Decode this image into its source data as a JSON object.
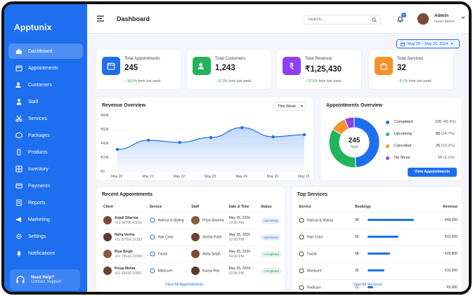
{
  "app": {
    "name": "Apptunix"
  },
  "sidebar": {
    "items": [
      {
        "label": "Dashboard",
        "icon": "home-icon",
        "active": true
      },
      {
        "label": "Appointments",
        "icon": "calendar-icon"
      },
      {
        "label": "Customers",
        "icon": "users-icon"
      },
      {
        "label": "Staff",
        "icon": "staff-icon"
      },
      {
        "label": "Services",
        "icon": "scissors-icon"
      },
      {
        "label": "Packages",
        "icon": "package-icon"
      },
      {
        "label": "Products",
        "icon": "product-icon"
      },
      {
        "label": "Inventory",
        "icon": "inventory-icon"
      },
      {
        "label": "Payments",
        "icon": "card-icon"
      },
      {
        "label": "Reports",
        "icon": "reports-icon"
      },
      {
        "label": "Marketing",
        "icon": "megaphone-icon"
      },
      {
        "label": "Settings",
        "icon": "gear-icon"
      },
      {
        "label": "Notifications",
        "icon": "bell-icon"
      }
    ],
    "help": {
      "title": "Need Help?",
      "subtitle": "Contact Support"
    }
  },
  "header": {
    "title": "Dashboard",
    "search_placeholder": "Search...",
    "notification_count": "5",
    "user_name": "Admin",
    "user_role": "Super Admin"
  },
  "date_range": "May 20 – May 26, 2024",
  "stats": [
    {
      "label": "Total Appointments",
      "value": "245",
      "change": "18.5%",
      "note": "from last week",
      "color": "#1e6ff0",
      "icon": "calendar-icon"
    },
    {
      "label": "Total Customers",
      "value": "1,243",
      "change": "12.3%",
      "note": "from last week",
      "color": "#22b45a",
      "icon": "users-icon"
    },
    {
      "label": "Total Revenue",
      "value": "₹1,25,430",
      "change": "22.6%",
      "note": "from last week",
      "color": "#8e3ff0",
      "icon": "rupee-icon"
    },
    {
      "label": "Total Services",
      "value": "32",
      "change": "8.7%",
      "note": "from last week",
      "color": "#f5922a",
      "icon": "bag-icon"
    }
  ],
  "revenue": {
    "title": "Revenue Overview",
    "period": "This Week"
  },
  "chart_data": [
    {
      "type": "area",
      "title": "Revenue Overview",
      "x": [
        "May 20",
        "May 21",
        "May 22",
        "May 23",
        "May 24",
        "May 25",
        "May 26"
      ],
      "series": [
        {
          "values": [
            32000,
            45000,
            42000,
            49000,
            63000,
            50000,
            53000
          ]
        }
      ],
      "yticks": [
        "₹80K",
        "₹60K",
        "₹40K",
        "₹20K",
        "₹0"
      ],
      "ylim": [
        0,
        80000
      ],
      "grid": true
    },
    {
      "type": "pie",
      "title": "Appointments Overview",
      "center_value": "245",
      "center_label": "Total",
      "slices": [
        {
          "name": "Completed",
          "value": 120,
          "pct": "48.9%",
          "color": "#1e6ff0"
        },
        {
          "name": "Upcoming",
          "value": 85,
          "pct": "34.7%",
          "color": "#22b45a"
        },
        {
          "name": "Cancelled",
          "value": 25,
          "pct": "10.2%",
          "color": "#f5922a"
        },
        {
          "name": "No Show",
          "value": 15,
          "pct": "6.1%",
          "color": "#8e3ff0"
        }
      ]
    }
  ],
  "appt_overview": {
    "title": "Appointments Overview",
    "button": "View Appointments"
  },
  "recent": {
    "title": "Recent Appointments",
    "columns": [
      "Client",
      "Service",
      "Staff",
      "Date & Time",
      "Status"
    ],
    "rows": [
      {
        "client": "Anjali Sharma",
        "phone": "+91 98765 43210",
        "service": "Haircut & Styling",
        "staff": "Priya Sharma",
        "date": "May 26, 2024",
        "time": "10:30 AM",
        "status": "Upcoming"
      },
      {
        "client": "Neha Verma",
        "phone": "+91 87654 32109",
        "service": "Hair Color",
        "staff": "Sneha Patel",
        "date": "May 26, 2024",
        "time": "12:00 PM",
        "status": "Upcoming"
      },
      {
        "client": "Riya Singh",
        "phone": "+91 76543 21098",
        "service": "Facial",
        "staff": "Anita Singh",
        "date": "May 25, 2024",
        "time": "04:00 PM",
        "status": "Completed"
      },
      {
        "client": "Pooja Mehta",
        "phone": "+91 65432 10987",
        "service": "Manicure",
        "staff": "Kavya Rao",
        "date": "May 25, 2024",
        "time": "02:00 PM",
        "status": "Completed"
      }
    ],
    "link": "View All Appointments"
  },
  "top": {
    "title": "Top Services",
    "columns": [
      "Service",
      "Bookings",
      "Revenue"
    ],
    "rows": [
      {
        "service": "Haircut & Styling",
        "bookings": 98,
        "revenue": "₹49,000"
      },
      {
        "service": "Hair Color",
        "bookings": 65,
        "revenue": "₹32,500"
      },
      {
        "service": "Facial",
        "bookings": 48,
        "revenue": "₹28,800"
      },
      {
        "service": "Manicure",
        "bookings": 35,
        "revenue": "₹10,500"
      },
      {
        "service": "Pedicure",
        "bookings": 12,
        "revenue": "₹6,000"
      }
    ],
    "link": "View All Services"
  }
}
